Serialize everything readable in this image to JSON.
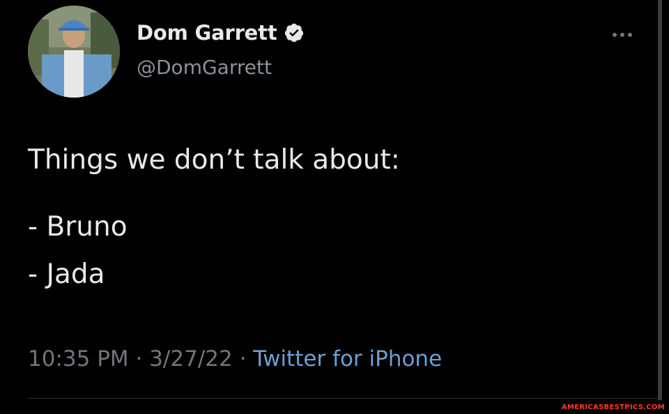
{
  "author": {
    "display_name": "Dom Garrett",
    "handle": "@DomGarrett",
    "verified": true,
    "avatar_icon": "profile-photo"
  },
  "tweet": {
    "lines": [
      "Things we don’t talk about:",
      "- Bruno",
      "- Jada"
    ]
  },
  "meta": {
    "time": "10:35 PM",
    "separator": " · ",
    "date": "3/27/22",
    "source": "Twitter for iPhone"
  },
  "menu": {
    "icon": "more-horizontal-icon"
  },
  "watermark": "AMERICASBESTPICS.COM",
  "colors": {
    "background": "#000000",
    "text": "#e7e9ea",
    "secondary_text": "#71767b",
    "link": "#6d9fd6",
    "verified_badge": "#e7e9ea",
    "watermark": "#ff3b1f"
  }
}
